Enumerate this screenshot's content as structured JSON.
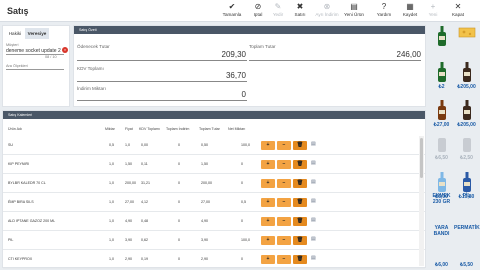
{
  "header": {
    "title": "Satış"
  },
  "toolbar": [
    {
      "icon": "✔",
      "label": "Tamamla",
      "enabled": true
    },
    {
      "icon": "⊘",
      "label": "Iptal",
      "enabled": true
    },
    {
      "icon": "✎",
      "label": "Yedir",
      "enabled": false
    },
    {
      "icon": "✖",
      "label": "Satırı",
      "enabled": true
    },
    {
      "icon": "⊗",
      "label": "Ayrı İndirim",
      "enabled": false
    },
    {
      "icon": "▤",
      "label": "Yeni Ürün",
      "enabled": true
    },
    {
      "icon": "?",
      "label": "Yardım",
      "enabled": true
    },
    {
      "icon": "▦",
      "label": "Kaydet",
      "enabled": true
    },
    {
      "icon": "+",
      "label": "Yeni",
      "enabled": false
    },
    {
      "icon": "✕",
      "label": "Kapat",
      "enabled": true
    }
  ],
  "left": {
    "tab1": "Hakiki",
    "tab2": "Veresiye",
    "customer_label": "Müşteri",
    "customer_value": "deneme socket update 2",
    "customer_sub": "08 / 10",
    "hint_label": "Ara Ölçekleri"
  },
  "summary": {
    "header": "Satış Özeti",
    "gross_label": "Ödenecek Tutar",
    "gross_value": "209,30",
    "total_label": "Toplam Tutar",
    "total_value": "246,00",
    "kdv_label": "KDV Toplamı",
    "kdv_value": "36,70",
    "disc_label": "İndirim Miktarı",
    "disc_value": "0"
  },
  "grid": {
    "header": "Satış Kalemleri",
    "columns": [
      "Ürün Adı",
      "Miktar",
      "Fiyat",
      "KDV Toplamı",
      "Toplam İndirim",
      "Toplam Tutar",
      "Net Miktarı"
    ],
    "rows": [
      {
        "name": "SU",
        "qty": "0,5",
        "price": "1,0",
        "kdv": "0,00",
        "disc": "0",
        "total": "0,50",
        "net": "100,0"
      },
      {
        "name": "KIP PEYNIRI",
        "qty": "1,0",
        "price": "1,50",
        "kdv": "0,11",
        "disc": "0",
        "total": "1,50",
        "net": "0"
      },
      {
        "name": "BYLBR KALEDR 70 CL",
        "qty": "1,0",
        "price": "200,00",
        "kdv": "31,21",
        "disc": "0",
        "total": "200,00",
        "net": "0"
      },
      {
        "name": "ÉMP BIRA SILS",
        "qty": "1,0",
        "price": "27,00",
        "kdv": "4,12",
        "disc": "0",
        "total": "27,00",
        "net": "0,5"
      },
      {
        "name": "ALD IPTANE GAZOZ 200 ML",
        "qty": "1,0",
        "price": "4,90",
        "kdv": "0,48",
        "disc": "0",
        "total": "4,90",
        "net": "0"
      },
      {
        "name": "PIL",
        "qty": "1,0",
        "price": "3,90",
        "kdv": "0,62",
        "disc": "0",
        "total": "3,90",
        "net": "100,0"
      },
      {
        "name": "CTI KEYPROX",
        "qty": "1,0",
        "price": "2,90",
        "kdv": "0,19",
        "disc": "0",
        "total": "2,90",
        "net": "0"
      }
    ]
  },
  "products": [
    {
      "label": "",
      "type": "bottle-green"
    },
    {
      "label": "",
      "type": "cheese"
    },
    {
      "label": "₺2",
      "type": "bottle-green"
    },
    {
      "label": "₺205,00",
      "type": "bottle-dark"
    },
    {
      "label": "₺27,00",
      "type": "bottle-beer"
    },
    {
      "label": "₺205,00",
      "type": "bottle-dark"
    },
    {
      "label": "₺6,50",
      "type": "can",
      "gray": true
    },
    {
      "label": "₺2,50",
      "type": "can",
      "gray": true
    },
    {
      "label": "₺5,00",
      "type": "bottle-water"
    },
    {
      "label": "₺10,80",
      "type": "bottle-blue"
    },
    {
      "label": "EKMEK 230 GR",
      "type": "text"
    },
    {
      "label": "PİL",
      "type": "text"
    },
    {
      "label": "YARA BANDI",
      "type": "text"
    },
    {
      "label": "PERMATİK",
      "type": "text"
    },
    {
      "label": "₺6,00",
      "type": "text"
    },
    {
      "label": "₺5,50",
      "type": "text"
    }
  ]
}
